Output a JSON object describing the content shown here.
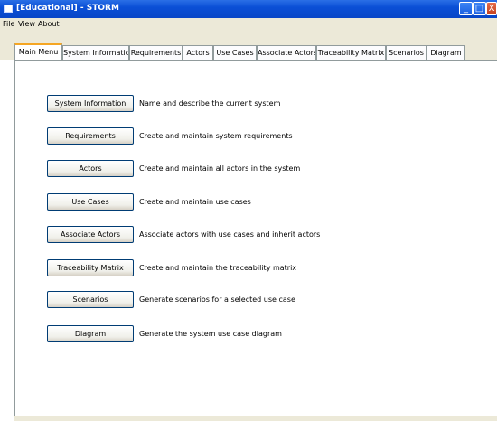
{
  "window": {
    "title": "[Educational] - STORM",
    "minimize_glyph": "_",
    "maximize_glyph": "□",
    "close_glyph": "X"
  },
  "menu": [
    "File",
    "View",
    "About"
  ],
  "tabs": [
    {
      "label": "Main Menu",
      "active": true
    },
    {
      "label": "System Information",
      "active": false
    },
    {
      "label": "Requirements",
      "active": false
    },
    {
      "label": "Actors",
      "active": false
    },
    {
      "label": "Use Cases",
      "active": false
    },
    {
      "label": "Associate Actors",
      "active": false
    },
    {
      "label": "Traceability Matrix",
      "active": false
    },
    {
      "label": "Scenarios",
      "active": false
    },
    {
      "label": "Diagram",
      "active": false
    }
  ],
  "main_menu": {
    "items": [
      {
        "button": "System Information",
        "description": "Name and describe the current system"
      },
      {
        "button": "Requirements",
        "description": "Create and maintain system requirements"
      },
      {
        "button": "Actors",
        "description": "Create and maintain all actors in the system"
      },
      {
        "button": "Use Cases",
        "description": "Create and maintain use cases"
      },
      {
        "button": "Associate Actors",
        "description": "Associate actors with use cases and inherit actors"
      },
      {
        "button": "Traceability Matrix",
        "description": "Create and maintain the traceability matrix"
      },
      {
        "button": "Scenarios",
        "description": "Generate scenarios for a selected use case"
      },
      {
        "button": "Diagram",
        "description": "Generate the system use case diagram"
      }
    ]
  },
  "colors": {
    "titlebar": "#0a4fd6",
    "active_tab_accent": "#f5a623",
    "button_border": "#003c74",
    "window_background": "#ECE9D8"
  }
}
